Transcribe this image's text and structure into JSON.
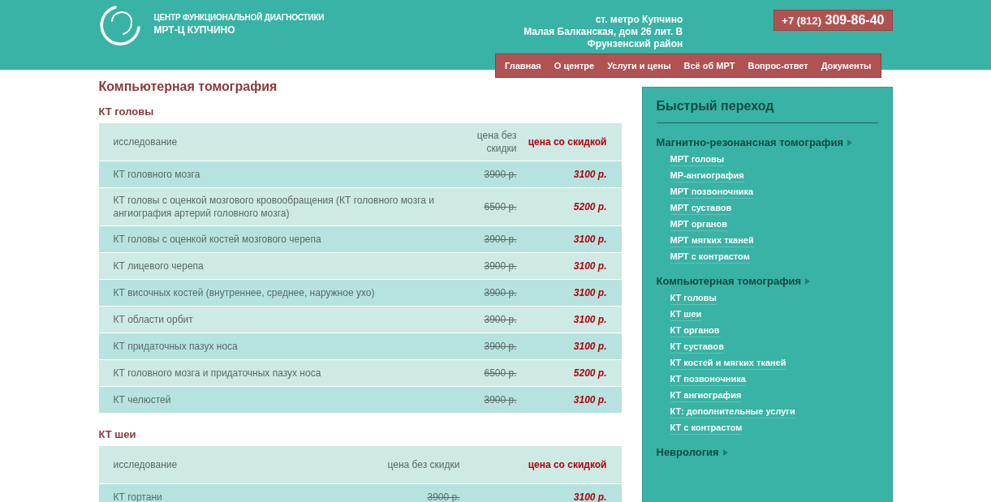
{
  "header": {
    "org_line": "ЦЕНТР ФУНКЦИОНАЛЬНОЙ ДИАГНОСТИКИ",
    "org_name": "МРТ-Ц КУПЧИНО",
    "address": [
      "ст. метро Купчино",
      "Малая Балканская, дом 26 лит. В",
      "Фрунзенский район"
    ],
    "phone_code": "+7 (812)",
    "phone_number": "309-86-40"
  },
  "nav": [
    "Главная",
    "О центре",
    "Услуги и цены",
    "Всё об МРТ",
    "Вопрос-ответ",
    "Документы"
  ],
  "page_title": "Компьютерная томография",
  "sections": [
    {
      "title": "КТ головы",
      "columns": [
        "исследование",
        "цена без скидки",
        "цена со скидкой"
      ],
      "rows": [
        {
          "name": "КТ головного мозга",
          "old_price": "3900 р.",
          "price": "3100 р."
        },
        {
          "name": "КТ головы с оценкой мозгового кровообращения (КТ головного мозга и ангиография артерий головного мозга)",
          "old_price": "6500 р.",
          "price": "5200 р."
        },
        {
          "name": "КТ головы с оценкой костей мозгового черепа",
          "old_price": "3900 р.",
          "price": "3100 р."
        },
        {
          "name": "КТ лицевого черепа",
          "old_price": "3900 р.",
          "price": "3100 р."
        },
        {
          "name": "КТ височных костей (внутреннее, среднее, наружное ухо)",
          "old_price": "3900 р.",
          "price": "3100 р."
        },
        {
          "name": "КТ области орбит",
          "old_price": "3900 р.",
          "price": "3100 р."
        },
        {
          "name": "КТ придаточных пазух носа",
          "old_price": "3900 р.",
          "price": "3100 р."
        },
        {
          "name": "КТ головного мозга и придаточных пазух носа",
          "old_price": "6500 р.",
          "price": "5200 р."
        },
        {
          "name": "КТ челюстей",
          "old_price": "3900 р.",
          "price": "3100 р."
        }
      ]
    },
    {
      "title": "КТ шеи",
      "columns": [
        "исследование",
        "цена без скидки",
        "цена со скидкой"
      ],
      "rows": [
        {
          "name": "КТ гортани",
          "old_price": "3900 р.",
          "price": "3100 р."
        }
      ]
    }
  ],
  "sidebar": {
    "title": "Быстрый переход",
    "groups": [
      {
        "label": "Магнитно-резонансная томография",
        "items": [
          "МРТ головы",
          "МР-ангиография",
          "МРТ позвоночника",
          "МРТ суставов",
          "МРТ органов",
          "МРТ мягких тканей",
          "МРТ с контрастом"
        ]
      },
      {
        "label": "Компьютерная томография",
        "items": [
          "КТ головы",
          "КТ шеи",
          "КТ органов",
          "КТ суставов",
          "КТ костей и мягких тканей",
          "КТ позвоночника",
          "КТ ангиография",
          "КТ: дополнительные услуги",
          "КТ с контрастом"
        ]
      },
      {
        "label": "Неврология"
      }
    ]
  }
}
